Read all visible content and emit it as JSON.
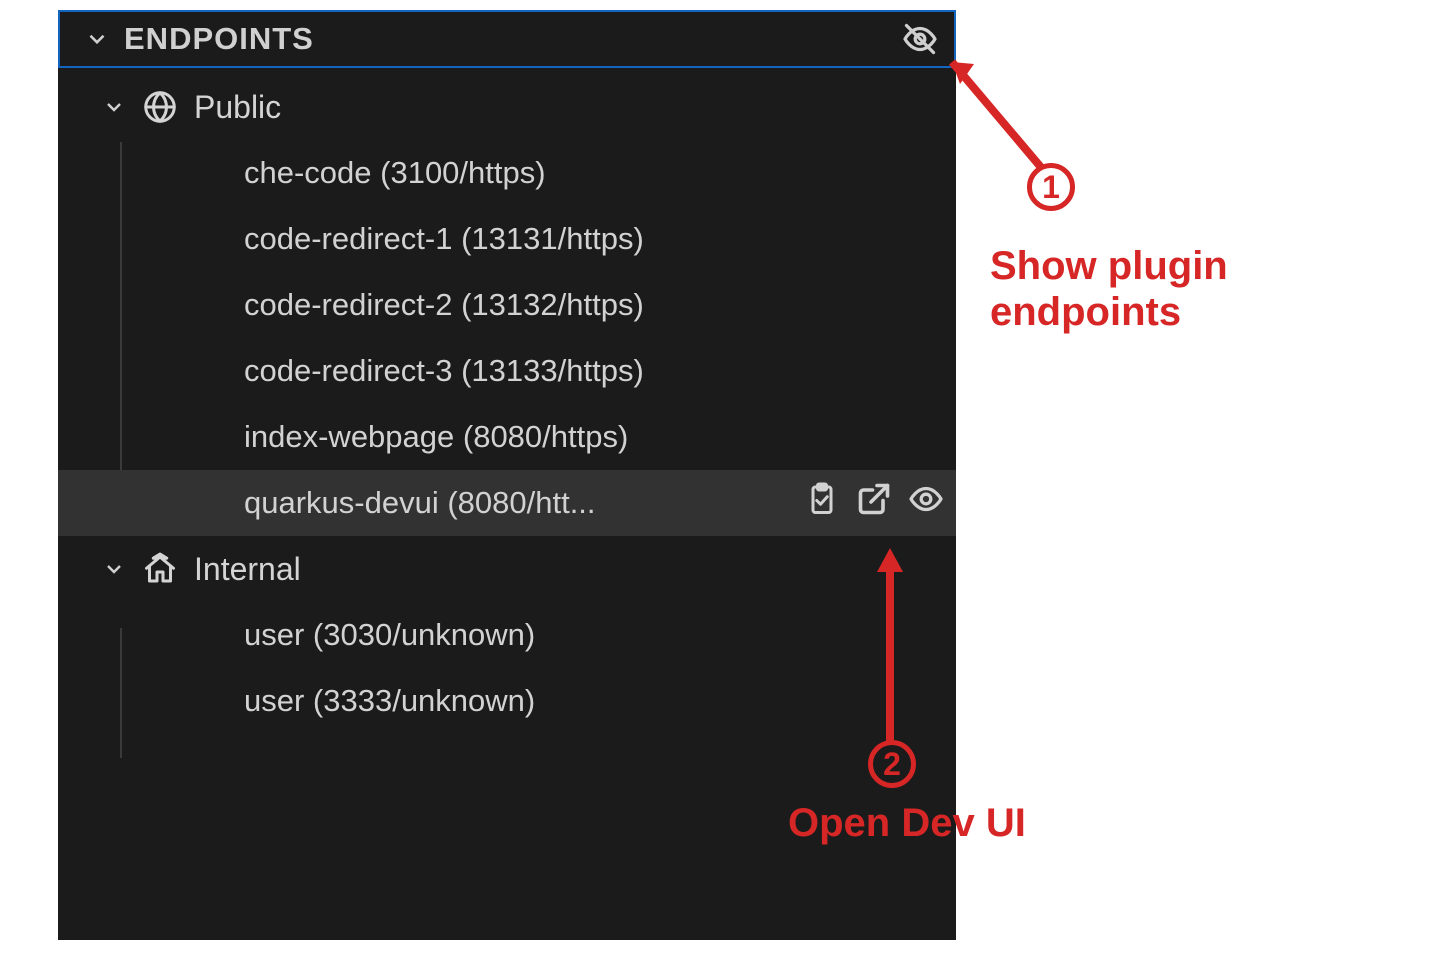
{
  "panel": {
    "title": "ENDPOINTS",
    "header_icon_name": "eye-off-icon"
  },
  "groups": [
    {
      "id": "public",
      "label": "Public",
      "icon_name": "globe-icon",
      "items": [
        {
          "label": "che-code (3100/https)"
        },
        {
          "label": "code-redirect-1 (13131/https)"
        },
        {
          "label": "code-redirect-2 (13132/https)"
        },
        {
          "label": "code-redirect-3 (13133/https)"
        },
        {
          "label": "index-webpage (8080/https)"
        },
        {
          "label": "quarkus-devui (8080/htt...",
          "highlight": true,
          "actions": [
            "clipboard-icon",
            "open-external-icon",
            "eye-icon"
          ]
        }
      ]
    },
    {
      "id": "internal",
      "label": "Internal",
      "icon_name": "home-icon",
      "items": [
        {
          "label": "user (3030/unknown)"
        },
        {
          "label": "user (3333/unknown)"
        }
      ]
    }
  ],
  "annotations": {
    "one": {
      "number": "1",
      "text_line1": "Show plugin",
      "text_line2": "endpoints"
    },
    "two": {
      "number": "2",
      "text": "Open Dev UI"
    }
  }
}
